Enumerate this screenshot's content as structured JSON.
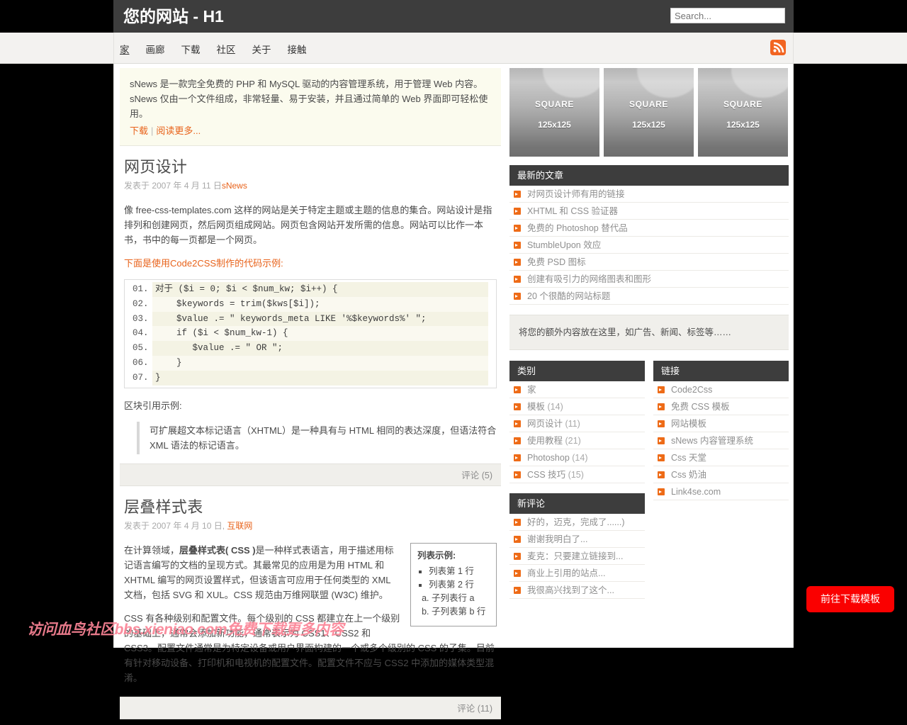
{
  "header": {
    "site_title": "您的网站 - H1",
    "search_placeholder": "Search...",
    "search_value": ""
  },
  "nav": {
    "items": [
      {
        "label": "家",
        "active": true
      },
      {
        "label": "画廊",
        "active": false
      },
      {
        "label": "下载",
        "active": false
      },
      {
        "label": "社区",
        "active": false
      },
      {
        "label": "关于",
        "active": false
      },
      {
        "label": "接触",
        "active": false
      }
    ],
    "rss_icon": "rss-icon"
  },
  "intro": {
    "text": "sNews 是一款完全免费的 PHP 和 MySQL 驱动的内容管理系统，用于管理 Web 内容。sNews 仅由一个文件组成，非常轻量、易于安装，并且通过简单的 Web 界面即可轻松使用。",
    "download_label": "下载",
    "separator": "|",
    "readmore_label": "阅读更多..."
  },
  "posts": [
    {
      "title": "网页设计",
      "meta_prefix": "发表于 2007 年 4 月 11 日",
      "meta_author": "sNews",
      "body1": "像 free-css-templates.com 这样的网站是关于特定主题或主题的信息的集合。网站设计是指排列和创建网页，然后网页组成网站。网页包含网站开发所需的信息。网站可以比作一本书，书中的每一页都是一个网页。",
      "code_lead_pre": "下面是使用",
      "code_lead_link": "Code2CSS",
      "code_lead_post": "制作的代码示例:",
      "code_lines": [
        {
          "num": "01.",
          "text": "对于 ($i = 0; $i < $num_kw; $i++) {"
        },
        {
          "num": "02.",
          "text": "    $keywords = trim($kws[$i]);"
        },
        {
          "num": "03.",
          "text": "    $value .= \" keywords_meta LIKE '%$keywords%' \";"
        },
        {
          "num": "04.",
          "text": "    if ($i < $num_kw-1) {"
        },
        {
          "num": "05.",
          "text": "       $value .= \" OR \";"
        },
        {
          "num": "06.",
          "text": "    }"
        },
        {
          "num": "07.",
          "text": "}"
        }
      ],
      "quote_lead": "区块引用示例:",
      "quote_text": "可扩展超文本标记语言（XHTML）是一种具有与 HTML 相同的表达深度，但语法符合 XML 语法的标记语言。",
      "comments_label": "评论 (5)"
    },
    {
      "title": "层叠样式表",
      "meta_prefix": "发表于 2007 年 4 月 10 日,",
      "meta_author": "互联网",
      "listbox": {
        "title": "列表示例:",
        "items": [
          "列表第 1 行",
          "列表第 2 行"
        ],
        "subitems": [
          "子列表行 a",
          "子列表第 b 行"
        ]
      },
      "body1_pre": "在计算领域，",
      "body1_bold": "层叠样式表( CSS )",
      "body1_post": "是一种样式表语言，用于描述用标记语言编写的文档的呈现方式。其最常见的应用是为用 HTML 和 XHTML 编写的网页设置样式，但该语言可应用于任何类型的 XML 文档，包括 SVG 和 XUL。CSS 规范由万维网联盟 (W3C) 维护。",
      "body2": "CSS 有各种级别和配置文件。每个级别的 CSS 都建立在上一个级别的基础上，通常会添加新功能，通常表示为 CSS1、CSS2 和 CSS3。配置文件通常是为特定设备或用户界面构建的一个或多个级别的 CSS 的子集。目前有针对移动设备、打印机和电视机的配置文件。配置文件不应与 CSS2 中添加的媒体类型混淆。",
      "comments_label": "评论 (11)"
    }
  ],
  "sidebar": {
    "squares": [
      {
        "label": "SQUARE",
        "size": "125x125"
      },
      {
        "label": "SQUARE",
        "size": "125x125"
      },
      {
        "label": "SQUARE",
        "size": "125x125"
      }
    ],
    "recent": {
      "title": "最新的文章",
      "items": [
        "对网页设计师有用的链接",
        "XHTML 和 CSS 验证器",
        "免费的 Photoshop 替代品",
        "StumbleUpon 效应",
        "免费 PSD 图标",
        "创建有吸引力的网络图表和图形",
        "20 个很酷的网站标题"
      ]
    },
    "note": "将您的额外内容放在这里，如广告、新闻、标签等……",
    "categories": {
      "title": "类别",
      "items": [
        {
          "label": "家",
          "count": ""
        },
        {
          "label": "模板",
          "count": "(14)"
        },
        {
          "label": "网页设计",
          "count": "(11)"
        },
        {
          "label": "使用教程",
          "count": "(21)"
        },
        {
          "label": "Photoshop",
          "count": "(14)"
        },
        {
          "label": "CSS 技巧",
          "count": "(15)"
        }
      ]
    },
    "links": {
      "title": "链接",
      "items": [
        {
          "label": "Code2Css",
          "count": ""
        },
        {
          "label": "免费 CSS 模板",
          "count": ""
        },
        {
          "label": "网站模板",
          "count": ""
        },
        {
          "label": "sNews 内容管理系统",
          "count": ""
        },
        {
          "label": "Css 天堂",
          "count": ""
        },
        {
          "label": "Css 奶油",
          "count": ""
        },
        {
          "label": "Link4se.com",
          "count": ""
        }
      ]
    },
    "new_comments": {
      "title": "新评论",
      "items": [
        "好的，迈克，完成了......)",
        "谢谢我明白了...",
        "麦克：只要建立链接到...",
        "商业上引用的站点...",
        "我很高兴找到了这个..."
      ]
    }
  },
  "overlay": {
    "watermark": "访问血鸟社区bbs.xieniao.com免费下载更多内容",
    "cta_label": "前往下载模板"
  }
}
